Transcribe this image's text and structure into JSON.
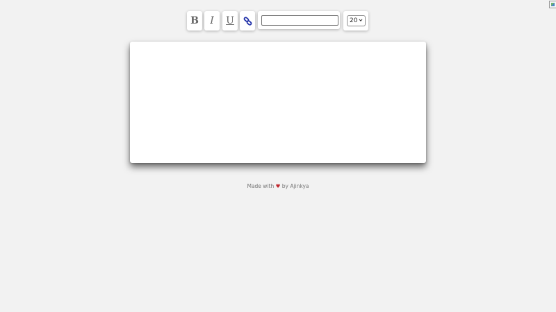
{
  "toolbar": {
    "bold_label": "B",
    "italic_label": "I",
    "underline_label": "U",
    "link_icon": "link-icon",
    "url_input": {
      "value": "",
      "placeholder": ""
    },
    "font_size": {
      "selected": "20"
    }
  },
  "editor": {
    "content": ""
  },
  "footer": {
    "prefix": "Made with",
    "heart": "♥",
    "suffix": "by Ajinkya"
  },
  "colors": {
    "background": "#f2f2f2",
    "link_icon": "#1f2fa8",
    "heart": "#c0262d"
  }
}
